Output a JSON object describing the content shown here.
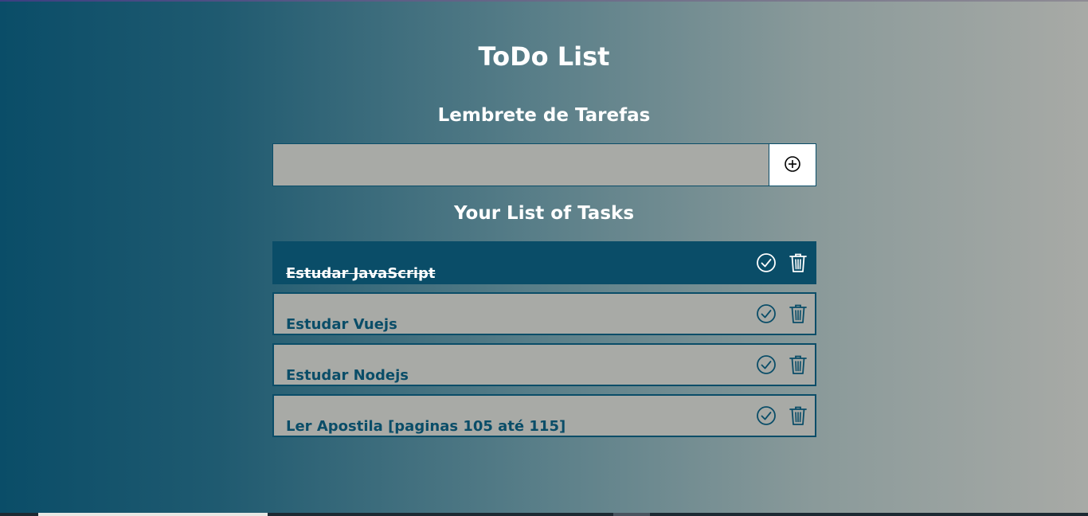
{
  "app": {
    "title": "ToDo List",
    "subtitle": "Lembrete de Tarefas",
    "list_heading": "Your List of Tasks"
  },
  "input": {
    "value": "",
    "placeholder": "",
    "add_icon": "plus-circle-icon"
  },
  "tasks": [
    {
      "text": "Estudar JavaScript",
      "done": true
    },
    {
      "text": "Estudar Vuejs",
      "done": false
    },
    {
      "text": "Estudar Nodejs",
      "done": false
    },
    {
      "text": "Ler Apostila [paginas 105 até 115]",
      "done": false
    }
  ],
  "icons": {
    "complete": "check-circle-icon",
    "delete": "trash-icon"
  },
  "colors": {
    "primary": "#0a4d68",
    "surface": "#a8aaa6",
    "text_light": "#ffffff"
  }
}
